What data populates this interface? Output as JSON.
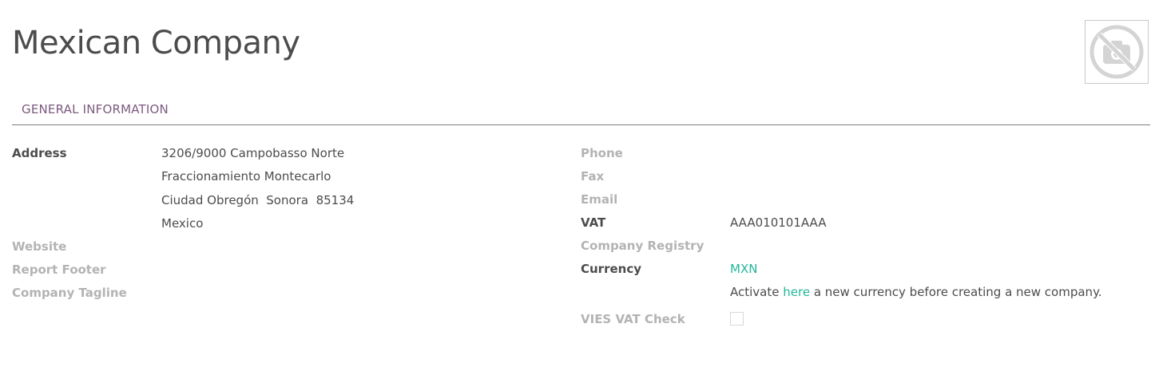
{
  "title": "Mexican Company",
  "logo": {
    "icon": "no-camera-icon"
  },
  "tabs": [
    {
      "label": "GENERAL INFORMATION"
    }
  ],
  "left": {
    "address_label": "Address",
    "address_lines": [
      "3206/9000 Campobasso Norte",
      "Fraccionamiento Montecarlo",
      "Ciudad Obregón  Sonora  85134",
      "Mexico"
    ],
    "website_label": "Website",
    "report_footer_label": "Report Footer",
    "company_tagline_label": "Company Tagline"
  },
  "right": {
    "phone_label": "Phone",
    "fax_label": "Fax",
    "email_label": "Email",
    "vat_label": "VAT",
    "vat_value": "AAA010101AAA",
    "company_registry_label": "Company Registry",
    "currency_label": "Currency",
    "currency_value": "MXN",
    "currency_hint_prefix": "Activate ",
    "currency_hint_link": "here",
    "currency_hint_suffix": " a new currency before creating a new company.",
    "vies_label": "VIES VAT Check",
    "vies_checked": false
  },
  "colors": {
    "accent": "#7c5a7f",
    "link": "#21b799",
    "text": "#4c4c4c",
    "muted": "#b3b3b3"
  }
}
